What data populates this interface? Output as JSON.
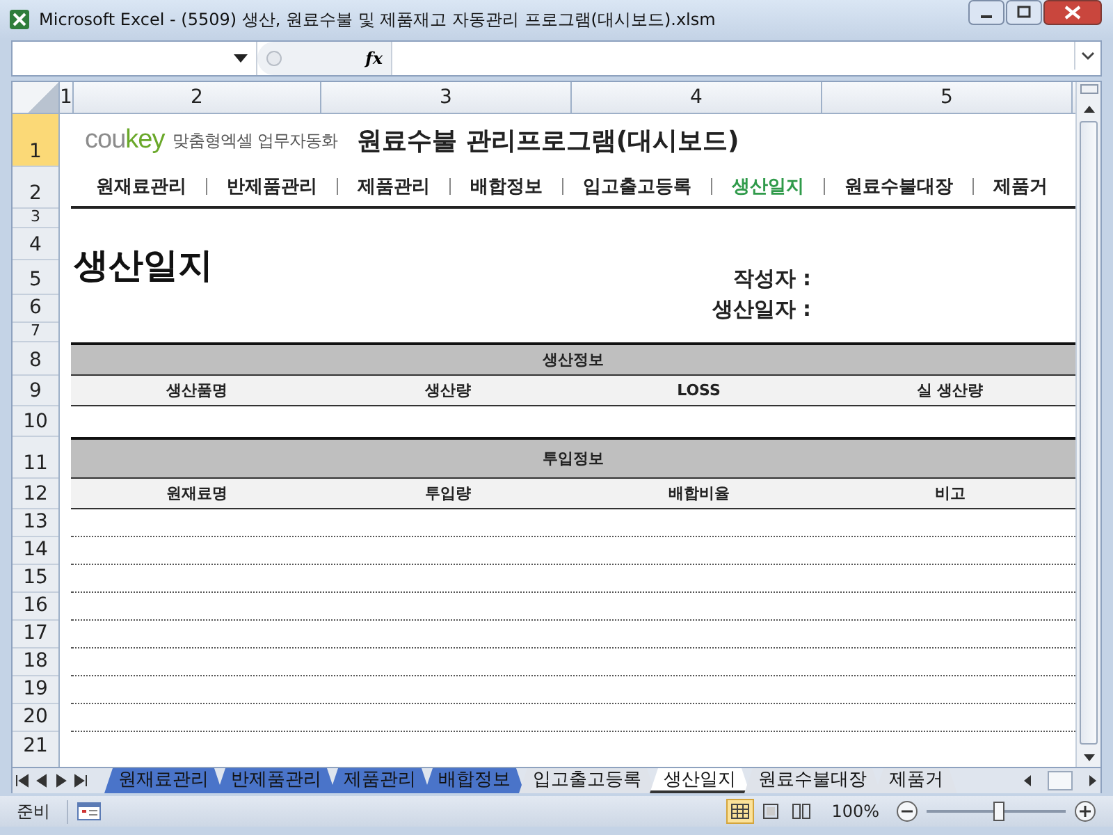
{
  "window": {
    "title": "Microsoft Excel - (5509) 생산, 원료수불 및 제품재고 자동관리 프로그램(대시보드).xlsm"
  },
  "formula_bar": {
    "function_button": "fx"
  },
  "column_headers": [
    "1",
    "2",
    "3",
    "4",
    "5"
  ],
  "row_numbers": [
    "1",
    "2",
    "3",
    "4",
    "5",
    "6",
    "7",
    "8",
    "9",
    "10",
    "11",
    "12",
    "13",
    "14",
    "15",
    "16",
    "17",
    "18",
    "19",
    "20",
    "21"
  ],
  "banner": {
    "brand_grey": "cou",
    "brand_green": "key",
    "tagline": "맞춤형엑셀 업무자동화",
    "title": "원료수불 관리프로그램(대시보드)"
  },
  "nav": [
    {
      "label": "원재료관리",
      "selected": false
    },
    {
      "label": "반제품관리",
      "selected": false
    },
    {
      "label": "제품관리",
      "selected": false
    },
    {
      "label": "배합정보",
      "selected": false
    },
    {
      "label": "입고출고등록",
      "selected": false
    },
    {
      "label": "생산일지",
      "selected": true
    },
    {
      "label": "원료수불대장",
      "selected": false
    },
    {
      "label": "제품거",
      "selected": false
    }
  ],
  "heading": "생산일지",
  "meta_labels": [
    "작성자 :",
    "생산일자 :"
  ],
  "sections": [
    {
      "title": "생산정보",
      "columns": [
        "생산품명",
        "생산량",
        "LOSS",
        "실 생산량"
      ]
    },
    {
      "title": "투입정보",
      "columns": [
        "원재료명",
        "투입량",
        "배합비율",
        "비고"
      ]
    }
  ],
  "sheet_tabs": [
    {
      "label": "원재료관리",
      "selected": false,
      "color": "#4a74c9"
    },
    {
      "label": "반제품관리",
      "selected": false,
      "color": "#4a74c9"
    },
    {
      "label": "제품관리",
      "selected": false,
      "color": "#4a74c9"
    },
    {
      "label": "배합정보",
      "selected": false,
      "color": "#4a74c9"
    },
    {
      "label": "입고출고등록",
      "selected": false,
      "color": "#dfe3ea"
    },
    {
      "label": "생산일지",
      "selected": true,
      "color": "#ffffff"
    },
    {
      "label": "원료수불대장",
      "selected": false,
      "color": "#dfe3ea"
    },
    {
      "label": "제품거",
      "selected": false,
      "color": "#dfe3ea"
    }
  ],
  "status_bar": {
    "mode": "준비",
    "views": [
      {
        "selected": true
      },
      {
        "selected": false
      },
      {
        "selected": false
      }
    ],
    "zoom": "100%",
    "zoom_slider": {
      "level": 0.52
    }
  }
}
